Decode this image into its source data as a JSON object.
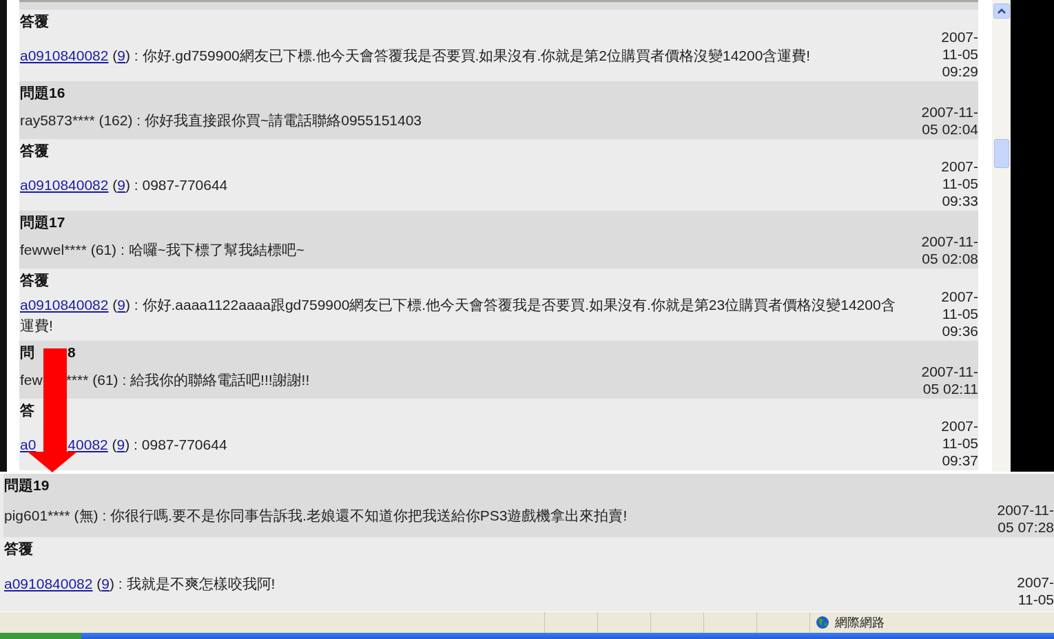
{
  "upper_entries": [
    {
      "kind": "answer",
      "heading": "答覆",
      "user": "a0910840082",
      "open": "(",
      "rating": "9",
      "close": ") :",
      "message": "你好.gd759900網友已下標.他今天會答覆我是否要買.如果沒有.你就是第2位購買者價格沒變14200含運費!",
      "date": [
        "2007-",
        "11-05",
        "09:29"
      ]
    },
    {
      "kind": "question",
      "heading": "問題16",
      "user": "ray5873****",
      "open": "(",
      "rating": "162",
      "close": ") :",
      "message": "你好我直接跟你買~請電話聯絡0955151403",
      "date": [
        "2007-11-",
        "05 02:04"
      ]
    },
    {
      "kind": "answer",
      "heading": "答覆",
      "user": "a0910840082",
      "open": "(",
      "rating": "9",
      "close": ") :",
      "message": "0987-770644",
      "date": [
        "2007-",
        "11-05",
        "09:33"
      ]
    },
    {
      "kind": "question",
      "heading": "問題17",
      "user": "fewwel****",
      "open": "(",
      "rating": "61",
      "close": ") :",
      "message": "哈囉~我下標了幫我結標吧~",
      "date": [
        "2007-11-",
        "05 02:08"
      ]
    },
    {
      "kind": "answer",
      "heading": "答覆",
      "user": "a0910840082",
      "open": "(",
      "rating": "9",
      "close": ") :",
      "message": "你好.aaaa1122aaaa跟gd759900網友已下標.他今天會答覆我是否要買.如果沒有.你就是第23位購買者價格沒變14200含運費!",
      "date": [
        "2007-",
        "11-05",
        "09:36"
      ]
    },
    {
      "kind": "question",
      "heading": "問",
      "heading_tail": "8",
      "user": "few",
      "user_tail": "****",
      "open": "(",
      "rating": "61",
      "close": ") :",
      "message": "給我你的聯絡電話吧!!!謝謝!!",
      "date": [
        "2007-11-",
        "05 02:11"
      ]
    },
    {
      "kind": "answer",
      "heading": "答",
      "user": "a0",
      "user_tail": "40082",
      "open": "(",
      "rating": "9",
      "close": ") :",
      "message": "0987-770644",
      "date": [
        "2007-",
        "11-05",
        "09:37"
      ]
    }
  ],
  "lower_entries": [
    {
      "kind": "question",
      "heading": "問題19",
      "user": "pig601****",
      "open": "(",
      "rating": "無",
      "close": ") :",
      "message": "你很行嗎.要不是你同事告訴我.老娘還不知道你把我送給你PS3遊戲機拿出來拍賣!",
      "date": [
        "2007-11-",
        "05 07:28"
      ]
    },
    {
      "kind": "answer",
      "heading": "答覆",
      "user": "a0910840082",
      "open": "(",
      "rating": "9",
      "close": ") :",
      "message": "我就是不爽怎樣咬我阿!",
      "date": [
        "2007-",
        "11-05"
      ]
    }
  ],
  "status_bar": {
    "zone": "網際網路"
  }
}
